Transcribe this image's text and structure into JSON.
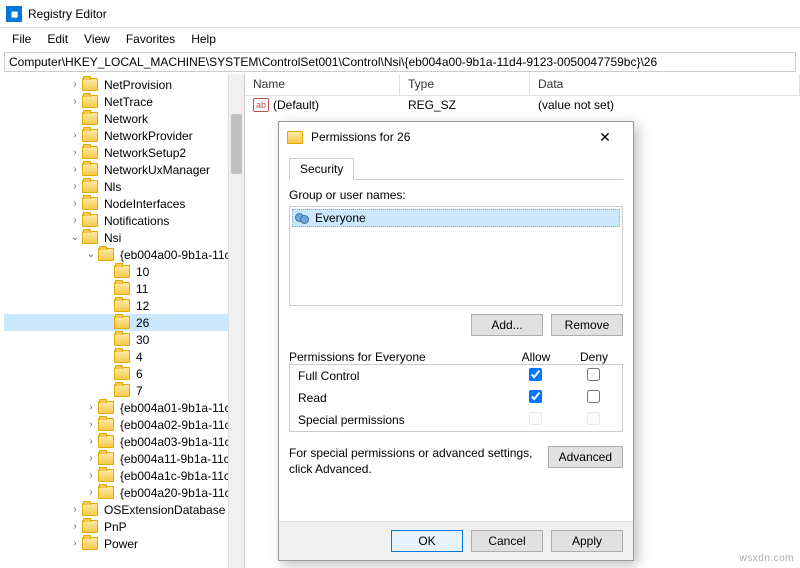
{
  "window": {
    "title": "Registry Editor"
  },
  "menu": {
    "file": "File",
    "edit": "Edit",
    "view": "View",
    "favorites": "Favorites",
    "help": "Help"
  },
  "addressbar": "Computer\\HKEY_LOCAL_MACHINE\\SYSTEM\\ControlSet001\\Control\\Nsi\\{eb004a00-9b1a-11d4-9123-0050047759bc}\\26",
  "tree": {
    "items": [
      {
        "d": 4,
        "t": ">",
        "n": "NetProvision"
      },
      {
        "d": 4,
        "t": ">",
        "n": "NetTrace"
      },
      {
        "d": 4,
        "t": "",
        "n": "Network"
      },
      {
        "d": 4,
        "t": ">",
        "n": "NetworkProvider"
      },
      {
        "d": 4,
        "t": ">",
        "n": "NetworkSetup2"
      },
      {
        "d": 4,
        "t": ">",
        "n": "NetworkUxManager"
      },
      {
        "d": 4,
        "t": ">",
        "n": "Nls"
      },
      {
        "d": 4,
        "t": ">",
        "n": "NodeInterfaces"
      },
      {
        "d": 4,
        "t": ">",
        "n": "Notifications"
      },
      {
        "d": 4,
        "t": "v",
        "n": "Nsi"
      },
      {
        "d": 5,
        "t": "v",
        "n": "{eb004a00-9b1a-11c"
      },
      {
        "d": 6,
        "t": "",
        "n": "10"
      },
      {
        "d": 6,
        "t": "",
        "n": "11"
      },
      {
        "d": 6,
        "t": "",
        "n": "12"
      },
      {
        "d": 6,
        "t": "",
        "n": "26",
        "sel": true
      },
      {
        "d": 6,
        "t": "",
        "n": "30"
      },
      {
        "d": 6,
        "t": "",
        "n": "4"
      },
      {
        "d": 6,
        "t": "",
        "n": "6"
      },
      {
        "d": 6,
        "t": "",
        "n": "7"
      },
      {
        "d": 5,
        "t": ">",
        "n": "{eb004a01-9b1a-11c"
      },
      {
        "d": 5,
        "t": ">",
        "n": "{eb004a02-9b1a-11c"
      },
      {
        "d": 5,
        "t": ">",
        "n": "{eb004a03-9b1a-11c"
      },
      {
        "d": 5,
        "t": ">",
        "n": "{eb004a11-9b1a-11c"
      },
      {
        "d": 5,
        "t": ">",
        "n": "{eb004a1c-9b1a-11c"
      },
      {
        "d": 5,
        "t": ">",
        "n": "{eb004a20-9b1a-11c"
      },
      {
        "d": 4,
        "t": ">",
        "n": "OSExtensionDatabase"
      },
      {
        "d": 4,
        "t": ">",
        "n": "PnP"
      },
      {
        "d": 4,
        "t": ">",
        "n": "Power"
      }
    ]
  },
  "list": {
    "cols": {
      "name": "Name",
      "type": "Type",
      "data": "Data"
    },
    "rows": [
      {
        "icon": "ab",
        "name": "(Default)",
        "type": "REG_SZ",
        "data": "(value not set)"
      }
    ]
  },
  "dialog": {
    "title": "Permissions for 26",
    "tab": "Security",
    "group_label": "Group or user names:",
    "principals": [
      {
        "name": "Everyone"
      }
    ],
    "add": "Add...",
    "remove": "Remove",
    "perm_header": "Permissions for Everyone",
    "allow": "Allow",
    "deny": "Deny",
    "perms": [
      {
        "name": "Full Control",
        "allow": true,
        "deny": false,
        "enabled": true
      },
      {
        "name": "Read",
        "allow": true,
        "deny": false,
        "enabled": true
      },
      {
        "name": "Special permissions",
        "allow": false,
        "deny": false,
        "enabled": false
      }
    ],
    "adv_text": "For special permissions or advanced settings, click Advanced.",
    "advanced": "Advanced",
    "ok": "OK",
    "cancel": "Cancel",
    "apply": "Apply"
  },
  "watermark": "wsxdn.com"
}
